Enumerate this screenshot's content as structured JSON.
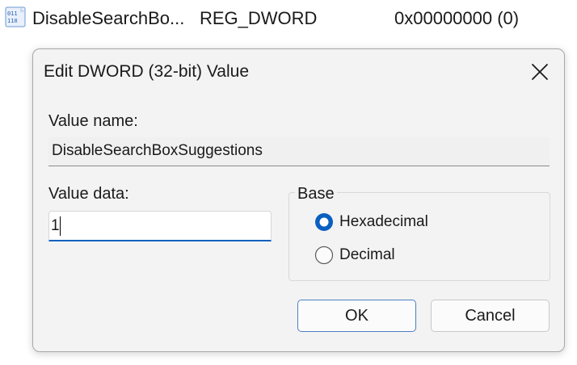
{
  "background_row": {
    "name": "DisableSearchBo...",
    "type": "REG_DWORD",
    "data": "0x00000000 (0)",
    "icon": "registry-binary-value-icon"
  },
  "dialog": {
    "title": "Edit DWORD (32-bit) Value",
    "close_icon": "close-icon",
    "value_name_label": "Value name:",
    "value_name": "DisableSearchBoxSuggestions",
    "value_data_label": "Value data:",
    "value_data": "1",
    "base": {
      "label": "Base",
      "options": [
        "Hexadecimal",
        "Decimal"
      ],
      "selected": "Hexadecimal"
    },
    "ok_label": "OK",
    "cancel_label": "Cancel"
  },
  "colors": {
    "accent": "#0a60c0",
    "dialog_bg": "#f3f3f3"
  }
}
